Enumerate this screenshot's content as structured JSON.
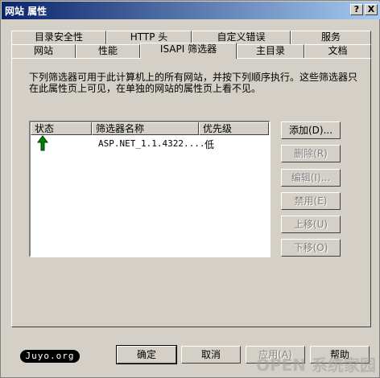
{
  "window": {
    "title": "网站 属性",
    "help_btn": "?",
    "close_btn": "X"
  },
  "tabs_row1": [
    "目录安全性",
    "HTTP 头",
    "自定义错误",
    "服务"
  ],
  "tabs_row2": [
    "网站",
    "性能",
    "ISAPI 筛选器",
    "主目录",
    "文档"
  ],
  "description": "下列筛选器可用于此计算机上的所有网站，并按下列顺序执行。这些筛选器只在此属性页上可见，在单独的网站的属性页上看不见。",
  "list": {
    "columns": [
      "状态",
      "筛选器名称",
      "优先级"
    ],
    "rows": [
      {
        "status_icon": "green-up-arrow-icon",
        "name": "ASP.NET_1.1.4322....",
        "priority": "低"
      }
    ]
  },
  "side_buttons": {
    "add": "添加(D)...",
    "remove": "删除(R)",
    "edit": "编辑(I)...",
    "disable": "禁用(E)",
    "move_up": "上移(U)",
    "move_down": "下移(O)"
  },
  "bottom_buttons": {
    "ok": "确定",
    "cancel": "取消",
    "apply": "应用(A)",
    "help": "帮助"
  },
  "badge": "Juyo.org",
  "watermark": "OPEN 系统家园"
}
